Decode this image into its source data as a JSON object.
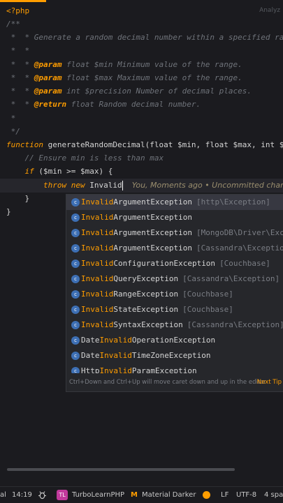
{
  "editor": {
    "hint": "Analyz",
    "lines": {
      "l1": "<?php",
      "l2": "/**",
      "l3": " *  * Generate a random decimal number within a specified range.",
      "l4": " *  *",
      "l5_tag": "@param",
      "l5_text": " float $min Minimum value of the range.",
      "l6_tag": "@param",
      "l6_text": " float $max Maximum value of the range.",
      "l7_tag": "@param",
      "l7_text": " int $precision Number of decimal places.",
      "l8_tag": "@return",
      "l8_text": " float Random decimal number.",
      "l9": " *",
      "l10": " */",
      "l11_kw": "function",
      "l11_text": " generateRandomDecimal(float $min, float $max, int $precision",
      "l12": "    // Ensure min is less than max",
      "l13_kw": "if",
      "l13_text": " ($min >= $max) {",
      "l14_kw": "throw new",
      "l14_text": " Invalid",
      "l14_blame": "You, Moments ago • Uncommitted changes",
      "l15": "}",
      "l16": "}"
    }
  },
  "completion": {
    "typed": "Invalid",
    "items": [
      {
        "pre": "",
        "match": "Invalid",
        "post": "ArgumentException",
        "pkg": "[http\\Exception]"
      },
      {
        "pre": "",
        "match": "Invalid",
        "post": "ArgumentException",
        "pkg": ""
      },
      {
        "pre": "",
        "match": "Invalid",
        "post": "ArgumentException",
        "pkg": "[MongoDB\\Driver\\Exception]"
      },
      {
        "pre": "",
        "match": "Invalid",
        "post": "ArgumentException",
        "pkg": "[Cassandra\\Exception]"
      },
      {
        "pre": "",
        "match": "Invalid",
        "post": "ConfigurationException",
        "pkg": "[Couchbase]"
      },
      {
        "pre": "",
        "match": "Invalid",
        "post": "QueryException",
        "pkg": "[Cassandra\\Exception]"
      },
      {
        "pre": "",
        "match": "Invalid",
        "post": "RangeException",
        "pkg": "[Couchbase]"
      },
      {
        "pre": "",
        "match": "Invalid",
        "post": "StateException",
        "pkg": "[Couchbase]"
      },
      {
        "pre": "",
        "match": "Invalid",
        "post": "SyntaxException",
        "pkg": "[Cassandra\\Exception]"
      },
      {
        "pre": "Date",
        "match": "Invalid",
        "post": "OperationException",
        "pkg": ""
      },
      {
        "pre": "Date",
        "match": "Invalid",
        "post": "TimeZoneException",
        "pkg": ""
      },
      {
        "pre": "Http",
        "match": "Invalid",
        "post": "ParamException",
        "pkg": ""
      }
    ],
    "footer_text": "Ctrl+Down and Ctrl+Up will move caret down and up in the editor",
    "next_tip": "Next Tip"
  },
  "status_bar": {
    "left_fragment": "al",
    "position": "14:19",
    "plugin_badge": "TL",
    "plugin_name": "TurboLearnPHP",
    "theme_name": "Material Darker",
    "line_ending": "LF",
    "encoding": "UTF-8",
    "indent": "4 spac"
  },
  "icons": {
    "class": "class-icon",
    "bug": "bug-icon",
    "theme": "material-theme-icon",
    "dot": "status-dot-icon"
  },
  "colors": {
    "accent": "#ff9d00",
    "background": "#1b1b1f",
    "popup": "#26272b",
    "comment": "#6f737a",
    "class_icon": "#3d6fb4"
  }
}
